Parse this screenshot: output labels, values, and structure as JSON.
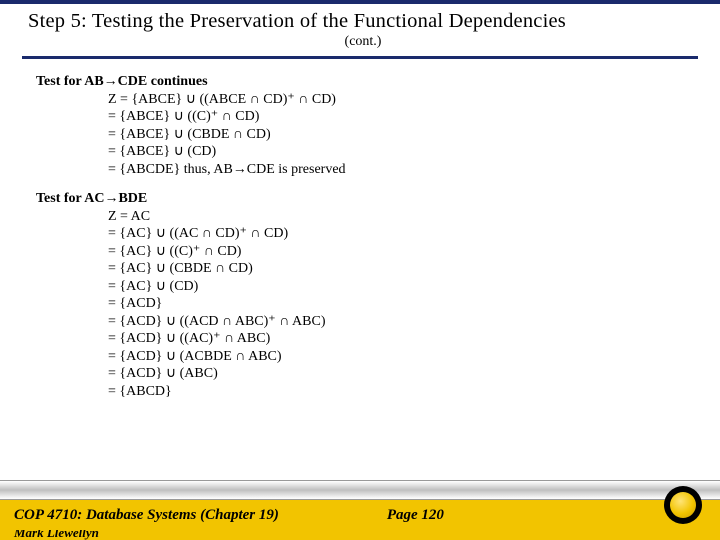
{
  "title": "Step 5: Testing the Preservation of the Functional Dependencies",
  "subtitle": "(cont.)",
  "block1": {
    "head": "Test for AB→CDE continues",
    "lines": [
      "Z = {ABCE} ∪ ((ABCE ∩ CD)⁺ ∩ CD)",
      "   = {ABCE} ∪ ((C)⁺ ∩ CD)",
      "   = {ABCE} ∪ (CBDE ∩ CD)",
      "   = {ABCE} ∪ (CD)",
      "   = {ABCDE} thus, AB→CDE is preserved"
    ]
  },
  "block2": {
    "head": "Test for AC→BDE",
    "lines": [
      "Z = AC",
      "   = {AC} ∪ ((AC ∩ CD)⁺ ∩ CD)",
      "   = {AC} ∪ ((C)⁺ ∩ CD)",
      "   = {AC} ∪ (CBDE ∩ CD)",
      "   = {AC} ∪ (CD)",
      "   = {ACD}",
      "   = {ACD} ∪ ((ACD ∩ ABC)⁺ ∩ ABC)",
      "   = {ACD} ∪ ((AC)⁺ ∩ ABC)",
      "   = {ACD} ∪ (ACBDE ∩ ABC)",
      "   = {ACD} ∪ (ABC)",
      "   = {ABCD}"
    ]
  },
  "footer": {
    "course": "COP 4710: Database Systems  (Chapter 19)",
    "page": "Page 120",
    "author": "Mark Llewellyn"
  }
}
